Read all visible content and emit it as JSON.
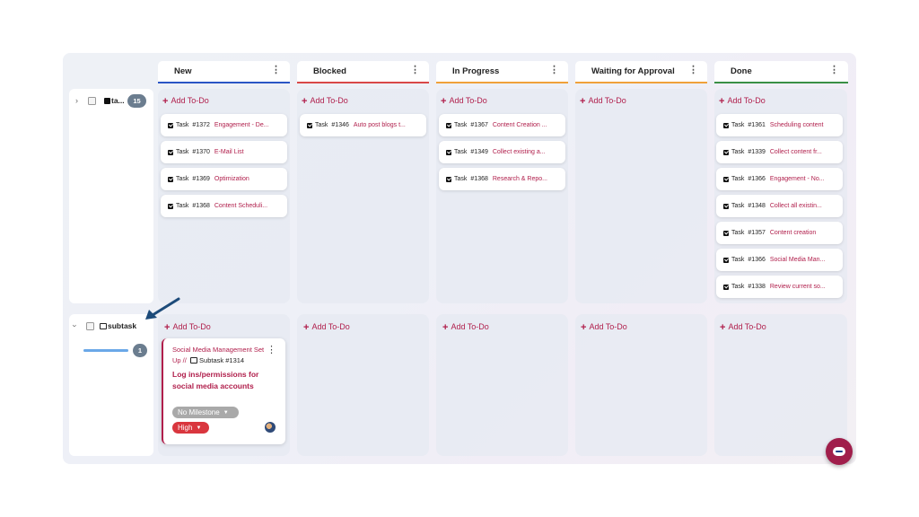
{
  "columns": [
    {
      "label": "New",
      "accent": "#2b56c5"
    },
    {
      "label": "Blocked",
      "accent": "#d94848"
    },
    {
      "label": "In Progress",
      "accent": "#f0a13a"
    },
    {
      "label": "Waiting for Approval",
      "accent": "#f0a13a"
    },
    {
      "label": "Done",
      "accent": "#3a8f45"
    }
  ],
  "add_todo_label": "Add To-Do",
  "rows": [
    {
      "label": "ta...",
      "count": "15"
    },
    {
      "label": "subtask",
      "count": "1",
      "progress": 1.0
    }
  ],
  "task_label": "Task",
  "cards": {
    "new": [
      {
        "num": "#1372",
        "title": "Engagement - De..."
      },
      {
        "num": "#1370",
        "title": "E-Mail List"
      },
      {
        "num": "#1369",
        "title": "Optimization"
      },
      {
        "num": "#1368",
        "title": "Content Scheduli..."
      }
    ],
    "blocked": [
      {
        "num": "#1346",
        "title": "Auto post blogs t..."
      }
    ],
    "in_progress": [
      {
        "num": "#1367",
        "title": "Content Creation ..."
      },
      {
        "num": "#1349",
        "title": "Collect existing a..."
      },
      {
        "num": "#1368",
        "title": "Research & Repo..."
      }
    ],
    "done": [
      {
        "num": "#1361",
        "title": "Scheduling content"
      },
      {
        "num": "#1339",
        "title": "Collect content fr..."
      },
      {
        "num": "#1366",
        "title": "Engagement - No..."
      },
      {
        "num": "#1348",
        "title": "Collect all existin..."
      },
      {
        "num": "#1357",
        "title": "Content creation"
      },
      {
        "num": "#1366",
        "title": "Social Media Man..."
      },
      {
        "num": "#1338",
        "title": "Review current so..."
      }
    ]
  },
  "subtask_card": {
    "parent": "Social Media Management Set",
    "parent_cont": "Up //",
    "type": "Subtask",
    "num": "#1314",
    "title_line1": "Log ins/permissions for",
    "title_line2": "social media accounts",
    "milestone": "No Milestone",
    "priority": "High"
  },
  "colors": {
    "accent": "#b01e4b",
    "badge": "#6b7d8f",
    "progress": "#6aa8e8",
    "arrow": "#1d4b7a",
    "priority": "#d9363e",
    "milestone": "#a9a9a9"
  },
  "icons": {
    "expand": "chevron-right-icon",
    "collapse": "chevron-down-icon",
    "kebab": "more-vertical-icon",
    "fab": "chat-icon"
  }
}
